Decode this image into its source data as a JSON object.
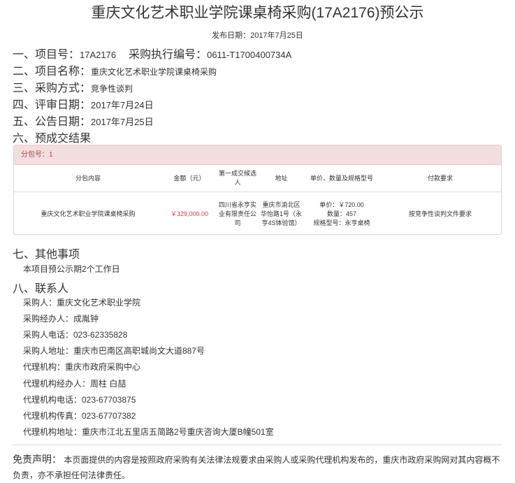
{
  "header": {
    "title": "重庆文化艺术职业学院课桌椅采购(17A2176)预公示",
    "pub_date_label": "发布日期：",
    "pub_date": "2017年7月25日"
  },
  "sections": {
    "s1": {
      "label": "一、项目号：",
      "value": "17A2176",
      "label2": "采购执行编号：",
      "value2": "0611-T1700400734A"
    },
    "s2": {
      "label": "二、项目名称：",
      "value": "重庆文化艺术职业学院课桌椅采购"
    },
    "s3": {
      "label": "三、采购方式：",
      "value": "竞争性谈判"
    },
    "s4": {
      "label": "四、评审日期：",
      "value": "2017年7月24日"
    },
    "s5": {
      "label": "五、公告日期：",
      "value": "2017年7月25日"
    },
    "s6": {
      "label": "六、预成交结果"
    },
    "s7": {
      "label": "七、其他事项",
      "value": "本项目预公示期2个工作日"
    },
    "s8": {
      "label": "八、联系人"
    }
  },
  "result_table": {
    "package": "分包号：1",
    "headers": [
      "分包内容",
      "金额（元）",
      "第一成交候选人",
      "地址",
      "单价、数量及规格型号",
      "付款要求"
    ],
    "row": {
      "content": "重庆文化艺术职业学院课桌椅采购",
      "amount": "￥329,000.00",
      "candidate": "四川省永亨实业有限责任公司",
      "address": "重庆市渝北区华怡路1号（永亨4S体验馆）",
      "unit_price": "单价：￥720.00",
      "quantity": "数量：457",
      "model": "规格型号：永亨桌椅",
      "payment": "按竞争性谈判文件要求"
    }
  },
  "contacts": [
    "采购人：重庆文化艺术职业学院",
    "采购经办人：成胤钟",
    "采购人电话：023-62335828",
    "采购人地址：重庆市巴南区高职城尚文大道887号",
    "代理机构：重庆市政府采购中心",
    "代理机构经办人：周柱 白喆",
    "代理机构电话：023-67703875",
    "代理机构传真：023-67707382",
    "代理机构地址：重庆市江北五里店五简路2号重庆咨询大厦B幢501室"
  ],
  "disclaimer": {
    "title": "免责声明：",
    "text": "本页面提供的内容是按照政府采购有关法律法规要求由采购人或采购代理机构发布的，重庆市政府采购网对其内容概不负责，亦不承担任何法律责任。"
  }
}
